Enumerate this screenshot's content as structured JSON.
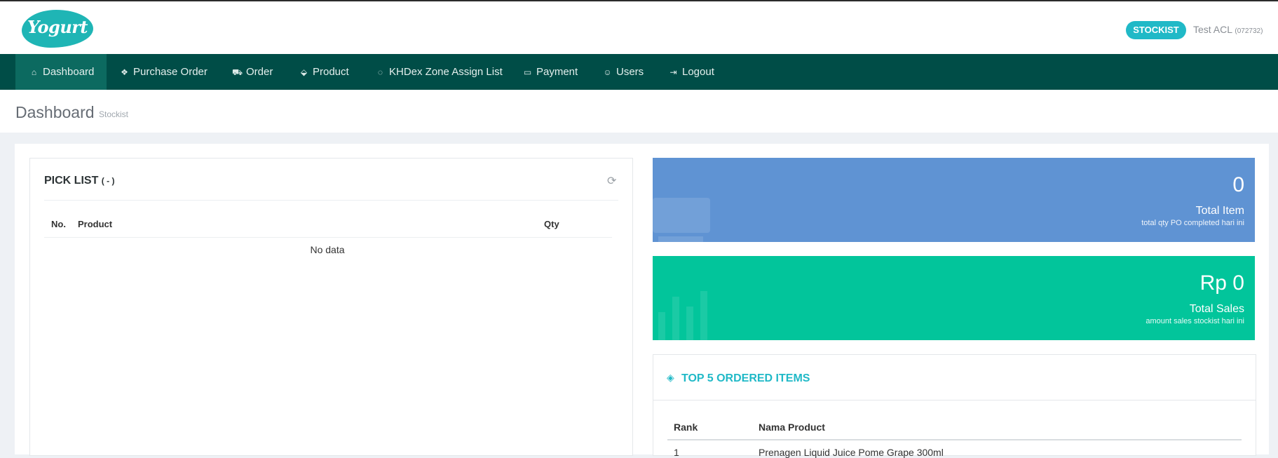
{
  "header": {
    "logo_text": "Yogurt",
    "role_badge": "STOCKIST",
    "user_name": "Test ACL",
    "user_code": "(072732)"
  },
  "nav": {
    "items": [
      {
        "label": "Dashboard",
        "icon": "home-icon"
      },
      {
        "label": "Purchase Order",
        "icon": "dropbox-icon"
      },
      {
        "label": "Order",
        "icon": "cart-icon"
      },
      {
        "label": "Product",
        "icon": "tag-icon"
      },
      {
        "label": "KHDex Zone Assign List",
        "icon": "bulb-icon"
      },
      {
        "label": "Payment",
        "icon": "folder-icon"
      },
      {
        "label": "Users",
        "icon": "users-icon"
      },
      {
        "label": "Logout",
        "icon": "logout-icon"
      }
    ],
    "active": "Dashboard"
  },
  "page": {
    "title": "Dashboard",
    "subtitle": "Stockist"
  },
  "pick_list": {
    "title": "PICK LIST",
    "title_suffix": "( - )",
    "columns": [
      "No.",
      "Product",
      "Qty"
    ],
    "empty_text": "No data"
  },
  "stats": {
    "total_item": {
      "value": "0",
      "label": "Total Item",
      "desc": "total qty PO completed hari ini",
      "color": "#5f93d3"
    },
    "total_sales": {
      "value": "Rp 0",
      "label": "Total Sales",
      "desc": "amount sales stockist hari ini",
      "color": "#02c59b"
    }
  },
  "top5": {
    "title": "TOP 5 ORDERED ITEMS",
    "columns": [
      "Rank",
      "Nama Product"
    ],
    "rows": [
      {
        "rank": "1",
        "product": "Prenagen Liquid Juice Pome Grape 300ml"
      }
    ]
  },
  "colors": {
    "nav_bg": "#004d47",
    "nav_active": "#0c6a60",
    "accent": "#20b9c7"
  }
}
